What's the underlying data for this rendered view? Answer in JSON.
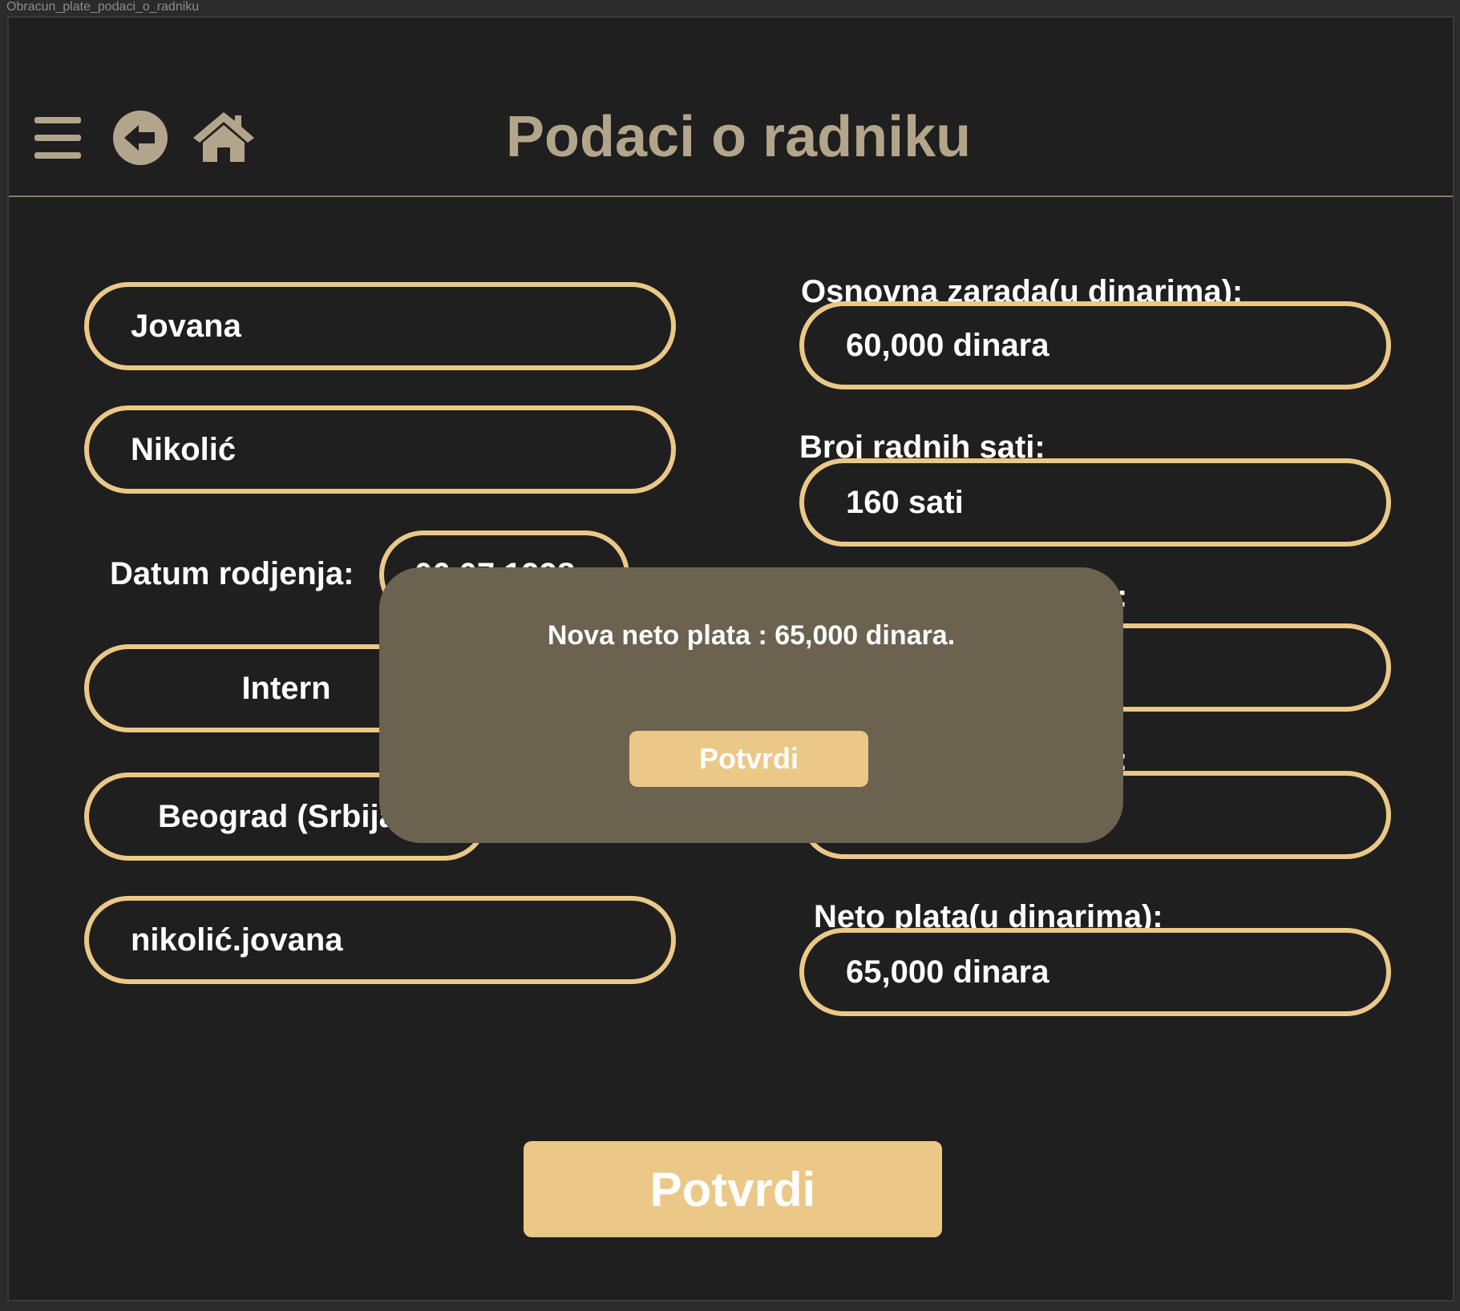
{
  "frame": {
    "label": "Obracun_plate_podaci_o_radniku"
  },
  "header": {
    "title": "Podaci o radniku",
    "icons": [
      "menu-icon",
      "back-arrow-icon",
      "home-icon"
    ]
  },
  "left_form": {
    "first_name": "Jovana",
    "last_name": "Nikolić",
    "birth_date_label": "Datum rodjenja:",
    "birth_date_value": "06.07.1998.",
    "position": "Intern",
    "city": "Beograd (Srbija)",
    "username": "nikolić.jovana"
  },
  "right_form": {
    "base_salary_label": "Osnovna zarada(u dinarima):",
    "base_salary_value": "60,000 dinara",
    "hours_label": "Broj radnih sati:",
    "hours_value": "160 sati",
    "net_salary_label": "Neto plata(u dinarima):",
    "net_salary_value": "65,000 dinara"
  },
  "actions": {
    "submit_label": "Potvrdi"
  },
  "modal": {
    "message": "Nova neto plata : 65,000 dinara.",
    "confirm_label": "Potvrdi"
  },
  "colors": {
    "background": "#1f1f1f",
    "accent": "#ebc887",
    "title": "#b3a58b",
    "modal": "#6b6250"
  }
}
